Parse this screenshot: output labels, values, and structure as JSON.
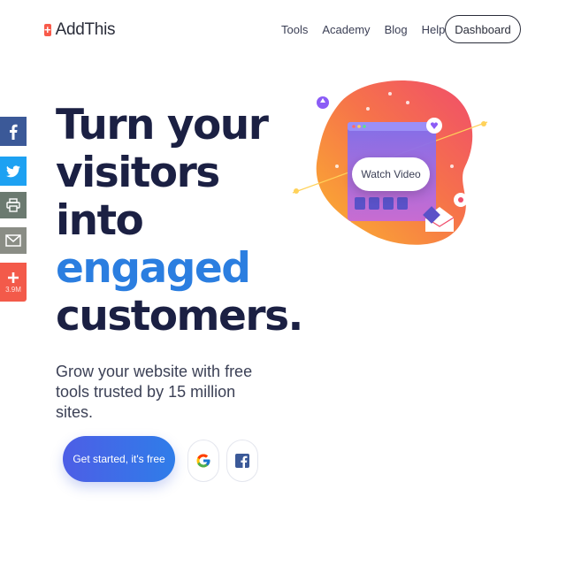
{
  "logo": {
    "mark": "+",
    "text": "AddThis"
  },
  "nav": {
    "items": [
      "Tools",
      "Academy",
      "Blog",
      "Help"
    ],
    "dashboard": "Dashboard"
  },
  "share_bar": {
    "count": "3.9M"
  },
  "hero": {
    "line1": "Turn your",
    "line2": "visitors",
    "line3": "into",
    "line4": "engaged",
    "line5": "customers.",
    "subtitle": "Grow your website with free tools trusted by 15 million sites."
  },
  "cta": {
    "label": "Get started, it's free"
  },
  "video": {
    "label": "Watch Video"
  },
  "colors": {
    "accent": "#2b7ee0",
    "brand": "#f85a4a",
    "cta_start": "#4d5ee6",
    "cta_end": "#2f7de9"
  },
  "icons": {
    "share": [
      "facebook-icon",
      "twitter-icon",
      "print-icon",
      "email-icon",
      "plus-icon"
    ],
    "social_login": [
      "google-icon",
      "facebook-icon"
    ]
  }
}
